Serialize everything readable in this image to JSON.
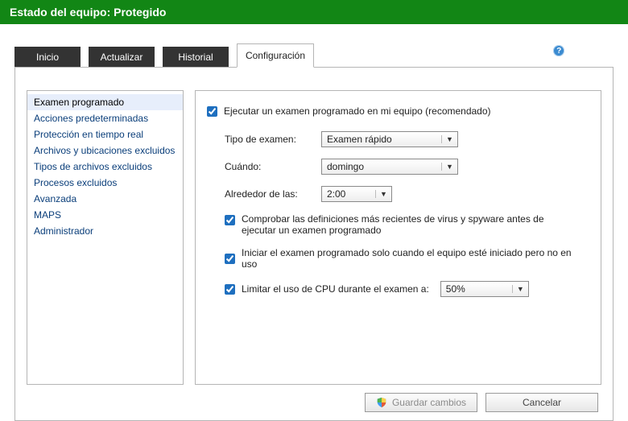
{
  "status_bar": {
    "text": "Estado del equipo: Protegido"
  },
  "tabs": [
    {
      "label": "Inicio"
    },
    {
      "label": "Actualizar"
    },
    {
      "label": "Historial"
    },
    {
      "label": "Configuración",
      "active": true
    }
  ],
  "help": {
    "label": "Ayuda"
  },
  "sidebar": {
    "items": [
      "Examen programado",
      "Acciones predeterminadas",
      "Protección en tiempo real",
      "Archivos y ubicaciones excluidos",
      "Tipos de archivos excluidos",
      "Procesos excluidos",
      "Avanzada",
      "MAPS",
      "Administrador"
    ],
    "selected_index": 0
  },
  "content": {
    "run_scheduled": {
      "checked": true,
      "label": "Ejecutar un examen programado en mi equipo (recomendado)"
    },
    "scan_type": {
      "label": "Tipo de examen:",
      "value": "Examen rápido"
    },
    "when": {
      "label": "Cuándo:",
      "value": "domingo"
    },
    "around": {
      "label": "Alrededor de las:",
      "value": "2:00"
    },
    "check_defs": {
      "checked": true,
      "label": "Comprobar las definiciones más recientes de virus y spyware antes de ejecutar un examen programado"
    },
    "start_idle": {
      "checked": true,
      "label": "Iniciar el examen programado solo cuando el equipo esté iniciado pero no en uso"
    },
    "cpu_limit": {
      "checked": true,
      "label": "Limitar el uso de CPU durante el examen a:",
      "value": "50%"
    }
  },
  "buttons": {
    "save": "Guardar cambios",
    "cancel": "Cancelar"
  }
}
